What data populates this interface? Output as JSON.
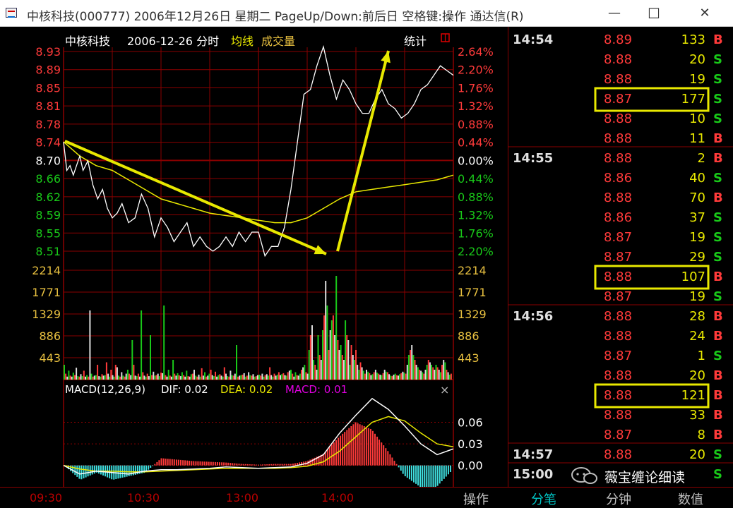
{
  "window": {
    "title": "中核科技(000777) 2006年12月26日 星期二 PageUp/Down:前后日 空格键:操作 通达信(R)",
    "buttons": [
      "—",
      "☐",
      "✕"
    ]
  },
  "chart_header": {
    "stock_name": "中核科技",
    "date_mode": "2006-12-26 分时",
    "avg_line_label": "均线",
    "volume_label": "成交量",
    "stats_label": "统计"
  },
  "colors": {
    "up": "#ff3a3a",
    "down": "#19c919",
    "neutral": "#ffffff",
    "avg": "#e8e800",
    "grid": "#8a0000",
    "volume_axis": "#e8c040",
    "macd_dea": "#e8e800",
    "macd_label": "#e000e0"
  },
  "price_axis": {
    "labels": [
      "8.93",
      "8.89",
      "8.85",
      "8.81",
      "8.78",
      "8.74",
      "8.70",
      "8.66",
      "8.62",
      "8.59",
      "8.55",
      "8.51"
    ],
    "pct_labels": [
      "2.64%",
      "2.20%",
      "1.76%",
      "1.32%",
      "0.88%",
      "0.44%",
      "0.00%",
      "0.44%",
      "0.88%",
      "1.32%",
      "1.76%",
      "2.20%"
    ]
  },
  "volume_axis": {
    "labels": [
      "2214",
      "1771",
      "1329",
      "886",
      "443"
    ]
  },
  "macd": {
    "header": {
      "name": "MACD(12,26,9)",
      "dif": "DIF: 0.02",
      "dea": "DEA: 0.02",
      "macd": "MACD: 0.01"
    },
    "close": "×",
    "axis_labels": [
      "0.06",
      "0.03",
      "0.00"
    ]
  },
  "chart_data": [
    {
      "type": "line",
      "series": [
        {
          "name": "price",
          "x": [
            0,
            2,
            4,
            6,
            8,
            10,
            12,
            15,
            18,
            21,
            24,
            27,
            30,
            33,
            36,
            40,
            44,
            48,
            52,
            56,
            60,
            64,
            68,
            72,
            76,
            80,
            84,
            88,
            92,
            96,
            100,
            104,
            108,
            112,
            116,
            120,
            124,
            128,
            132,
            136,
            140,
            144,
            148,
            152,
            156,
            160,
            164,
            168,
            172,
            176,
            180,
            184,
            188,
            192,
            196,
            200,
            204,
            208,
            212,
            216,
            220,
            224,
            228,
            232,
            236,
            240
          ],
          "y": [
            8.74,
            8.68,
            8.69,
            8.67,
            8.69,
            8.71,
            8.68,
            8.7,
            8.65,
            8.62,
            8.64,
            8.6,
            8.58,
            8.59,
            8.61,
            8.57,
            8.58,
            8.63,
            8.6,
            8.54,
            8.58,
            8.56,
            8.53,
            8.55,
            8.57,
            8.52,
            8.54,
            8.52,
            8.51,
            8.52,
            8.54,
            8.52,
            8.55,
            8.53,
            8.55,
            8.55,
            8.5,
            8.52,
            8.52,
            8.56,
            8.64,
            8.74,
            8.84,
            8.85,
            8.9,
            8.94,
            8.88,
            8.83,
            8.87,
            8.85,
            8.82,
            8.8,
            8.8,
            8.83,
            8.85,
            8.82,
            8.81,
            8.79,
            8.8,
            8.82,
            8.85,
            8.86,
            8.88,
            8.9,
            8.89,
            8.88
          ]
        },
        {
          "name": "均线",
          "x": [
            0,
            10,
            20,
            30,
            40,
            50,
            60,
            70,
            80,
            90,
            100,
            110,
            120,
            130,
            140,
            150,
            160,
            170,
            180,
            190,
            200,
            210,
            220,
            230,
            240
          ],
          "y": [
            8.74,
            8.71,
            8.69,
            8.68,
            8.66,
            8.64,
            8.62,
            8.61,
            8.6,
            8.59,
            8.585,
            8.58,
            8.575,
            8.57,
            8.57,
            8.58,
            8.6,
            8.62,
            8.635,
            8.64,
            8.645,
            8.65,
            8.655,
            8.66,
            8.67
          ]
        }
      ],
      "xlim": [
        0,
        240
      ],
      "ylim": [
        8.51,
        8.93
      ],
      "ylabel": "",
      "x_tick_labels": [
        "09:30",
        "10:30",
        "13:00",
        "14:00"
      ],
      "annotations": [
        "yellow arrow down from 09:30 to about 14:00 low",
        "yellow arrow up from the low to the 8.93 high"
      ]
    },
    {
      "type": "bar",
      "series": [
        {
          "name": "成交量",
          "values": [
            300,
            120,
            60,
            180,
            80,
            60,
            140,
            90,
            240,
            70,
            60,
            110,
            70,
            180,
            60,
            90,
            60,
            1400,
            120,
            60,
            80,
            90,
            300,
            70,
            60,
            110,
            80,
            90,
            350,
            120,
            60,
            200,
            90,
            60,
            300,
            250,
            80,
            60,
            150,
            80,
            60,
            120,
            200,
            120,
            90,
            800,
            300,
            80,
            70,
            120,
            60,
            1400,
            150,
            80,
            60,
            120,
            70,
            900,
            90,
            160,
            80,
            90,
            120,
            70,
            140,
            130,
            1500,
            90,
            60,
            200,
            80,
            60,
            400,
            120,
            80,
            130,
            90,
            70,
            150,
            90,
            60,
            180,
            70,
            60,
            110,
            120,
            200,
            80,
            60,
            100,
            60,
            230,
            80,
            150,
            60,
            80,
            120,
            200,
            90,
            70,
            160,
            60,
            90,
            110,
            80,
            60,
            250,
            120,
            70,
            60,
            180,
            90,
            80,
            120,
            700,
            60,
            80,
            90,
            100,
            130,
            60,
            80,
            150,
            90,
            80,
            110,
            60,
            70,
            90,
            100,
            80,
            120,
            60,
            90,
            110,
            80,
            250,
            90,
            60,
            120,
            80,
            100,
            150,
            90,
            110,
            130,
            90,
            80,
            150,
            180,
            200,
            120,
            60,
            150,
            90,
            80,
            120,
            200,
            250,
            300,
            150,
            120,
            600,
            900,
            1100,
            400,
            300,
            200,
            900,
            500,
            400,
            1000,
            1300,
            2000,
            1500,
            600,
            1000,
            1200,
            1300,
            900,
            2100,
            800,
            600,
            700,
            500,
            400,
            1200,
            900,
            800,
            300,
            700,
            500,
            400,
            600,
            300,
            200,
            350,
            250,
            180,
            120,
            200,
            160,
            130,
            90,
            110,
            150,
            200,
            140,
            120,
            100,
            90,
            130,
            200,
            160,
            150,
            110,
            80,
            70,
            100,
            120,
            90,
            80,
            110,
            130,
            160,
            140,
            120,
            300,
            500,
            600,
            700,
            500,
            400,
            300,
            250,
            200,
            180,
            150,
            120,
            200,
            300,
            400,
            350,
            300,
            250,
            200,
            300,
            250,
            200,
            150,
            300,
            400,
            350,
            200,
            150,
            100,
            120
          ]
        }
      ],
      "ylim": [
        0,
        2214
      ]
    },
    {
      "type": "line",
      "series": [
        {
          "name": "DIF",
          "x": [
            0,
            10,
            20,
            30,
            40,
            50,
            60,
            70,
            80,
            90,
            100,
            110,
            120,
            130,
            140,
            150,
            160,
            170,
            180,
            190,
            200,
            210,
            220,
            230,
            240
          ],
          "y": [
            0.0,
            -0.012,
            -0.008,
            -0.01,
            -0.012,
            -0.008,
            -0.006,
            -0.006,
            -0.005,
            -0.004,
            -0.002,
            -0.003,
            -0.004,
            -0.003,
            -0.002,
            0.003,
            0.015,
            0.045,
            0.07,
            0.093,
            0.078,
            0.055,
            0.03,
            0.015,
            0.023
          ]
        },
        {
          "name": "DEA",
          "x": [
            0,
            10,
            20,
            30,
            40,
            50,
            60,
            70,
            80,
            90,
            100,
            110,
            120,
            130,
            140,
            150,
            160,
            170,
            180,
            190,
            200,
            210,
            220,
            230,
            240
          ],
          "y": [
            0.0,
            -0.005,
            -0.008,
            -0.008,
            -0.009,
            -0.009,
            -0.008,
            -0.007,
            -0.006,
            -0.005,
            -0.004,
            -0.004,
            -0.004,
            -0.004,
            -0.003,
            -0.001,
            0.005,
            0.02,
            0.04,
            0.06,
            0.068,
            0.062,
            0.045,
            0.03,
            0.026
          ]
        }
      ],
      "macd_bars": [
        0.0,
        -0.02,
        -0.01,
        -0.02,
        -0.015,
        -0.01,
        0.01,
        0.008,
        0.006,
        0.005,
        0.004,
        0.002,
        0.001,
        0.002,
        0.002,
        0.006,
        0.016,
        0.04,
        0.06,
        0.05,
        0.02,
        -0.014,
        -0.03,
        -0.03,
        -0.006
      ],
      "ylim": [
        -0.02,
        0.09
      ]
    }
  ],
  "ticks": {
    "rows": [
      {
        "time": "14:54",
        "price": "8.89",
        "vol": "133",
        "side": "B"
      },
      {
        "time": "",
        "price": "8.88",
        "vol": "20",
        "side": "S"
      },
      {
        "time": "",
        "price": "8.88",
        "vol": "19",
        "side": "S"
      },
      {
        "time": "",
        "price": "8.87",
        "vol": "177",
        "side": "S"
      },
      {
        "time": "",
        "price": "8.88",
        "vol": "10",
        "side": "S"
      },
      {
        "time": "",
        "price": "8.88",
        "vol": "11",
        "side": "B"
      },
      {
        "time": "14:55",
        "price": "8.88",
        "vol": "2",
        "side": "B"
      },
      {
        "time": "",
        "price": "8.86",
        "vol": "40",
        "side": "S"
      },
      {
        "time": "",
        "price": "8.88",
        "vol": "70",
        "side": "B"
      },
      {
        "time": "",
        "price": "8.86",
        "vol": "37",
        "side": "S"
      },
      {
        "time": "",
        "price": "8.87",
        "vol": "19",
        "side": "S"
      },
      {
        "time": "",
        "price": "8.87",
        "vol": "29",
        "side": "S"
      },
      {
        "time": "",
        "price": "8.88",
        "vol": "107",
        "side": "B"
      },
      {
        "time": "",
        "price": "8.87",
        "vol": "19",
        "side": "S"
      },
      {
        "time": "14:56",
        "price": "8.88",
        "vol": "28",
        "side": "B"
      },
      {
        "time": "",
        "price": "8.88",
        "vol": "24",
        "side": "B"
      },
      {
        "time": "",
        "price": "8.87",
        "vol": "1",
        "side": "S"
      },
      {
        "time": "",
        "price": "8.88",
        "vol": "20",
        "side": "B"
      },
      {
        "time": "",
        "price": "8.88",
        "vol": "121",
        "side": "B"
      },
      {
        "time": "",
        "price": "8.88",
        "vol": "33",
        "side": "B"
      },
      {
        "time": "",
        "price": "8.87",
        "vol": "8",
        "side": "B"
      },
      {
        "time": "14:57",
        "price": "8.88",
        "vol": "20",
        "side": "S"
      },
      {
        "time": "15:00",
        "price": "",
        "vol": "",
        "side": "S"
      }
    ],
    "highlight_rows": [
      3,
      12,
      18
    ]
  },
  "bottom": {
    "time_labels": [
      "09:30",
      "10:30",
      "13:00",
      "14:00"
    ],
    "tabs": [
      "操作",
      "分笔",
      "分钟",
      "数值"
    ],
    "active_tab": "分笔"
  },
  "watermark": "薇宝缠论细读"
}
